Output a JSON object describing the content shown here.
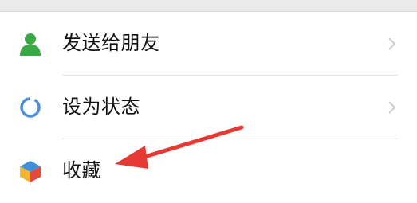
{
  "menu": {
    "items": [
      {
        "label": "发送给朋友",
        "icon": "friend-icon",
        "chevron": true
      },
      {
        "label": "设为状态",
        "icon": "status-ring-icon",
        "chevron": true
      },
      {
        "label": "收藏",
        "icon": "favorite-cube-icon",
        "chevron": false
      }
    ]
  },
  "colors": {
    "friend_icon": "#3aa845",
    "status_ring": "#4a90d9",
    "annotation_arrow": "#e53935",
    "text": "#111111",
    "divider": "#e1e1e1"
  },
  "annotation": {
    "type": "arrow",
    "points_to": "收藏"
  }
}
